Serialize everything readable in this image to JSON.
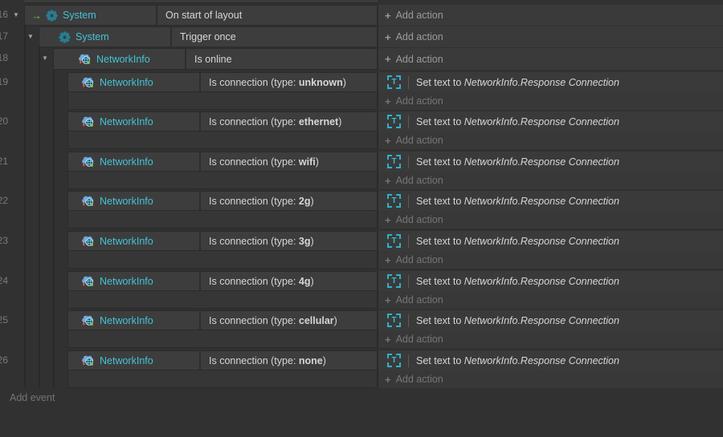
{
  "icons": {
    "plus": "+",
    "collapse": "▼",
    "trigger_arrow": "→",
    "text_object": "T"
  },
  "colors": {
    "object_name": "#44c3d8",
    "trigger_arrow_green": "#74c044",
    "gear_teal": "#267f95",
    "text_icon_cyan": "#35bdd6",
    "background": "#313131",
    "block": "#3d3d3d"
  },
  "sheet": {
    "add_event_label": "Add event",
    "add_action_label": "Add action",
    "events": [
      {
        "number": "16",
        "object": "System",
        "icon": "gear",
        "trigger_arrow": true,
        "collapsible": true,
        "condition": {
          "pre": "On start of layout",
          "bold": "",
          "post": ""
        },
        "actions": []
      },
      {
        "number": "17",
        "object": "System",
        "icon": "gear",
        "trigger_arrow": false,
        "collapsible": true,
        "condition": {
          "pre": "Trigger once",
          "bold": "",
          "post": ""
        },
        "actions": []
      },
      {
        "number": "18",
        "object": "NetworkInfo",
        "icon": "network",
        "trigger_arrow": false,
        "collapsible": true,
        "condition": {
          "pre": "Is online",
          "bold": "",
          "post": ""
        },
        "actions": []
      },
      {
        "number": "19",
        "object": "NetworkInfo",
        "icon": "network",
        "trigger_arrow": false,
        "collapsible": false,
        "condition": {
          "pre": "Is connection (type: ",
          "bold": "unknown",
          "post": ")"
        },
        "actions": [
          {
            "icon": "text",
            "text": "Set text to ",
            "expression": "NetworkInfo.Response Connection"
          }
        ]
      },
      {
        "number": "20",
        "object": "NetworkInfo",
        "icon": "network",
        "trigger_arrow": false,
        "collapsible": false,
        "condition": {
          "pre": "Is connection (type: ",
          "bold": "ethernet",
          "post": ")"
        },
        "actions": [
          {
            "icon": "text",
            "text": "Set text to ",
            "expression": "NetworkInfo.Response Connection"
          }
        ]
      },
      {
        "number": "21",
        "object": "NetworkInfo",
        "icon": "network",
        "trigger_arrow": false,
        "collapsible": false,
        "condition": {
          "pre": "Is connection (type: ",
          "bold": "wifi",
          "post": ")"
        },
        "actions": [
          {
            "icon": "text",
            "text": "Set text to ",
            "expression": "NetworkInfo.Response Connection"
          }
        ]
      },
      {
        "number": "22",
        "object": "NetworkInfo",
        "icon": "network",
        "trigger_arrow": false,
        "collapsible": false,
        "condition": {
          "pre": "Is connection (type: ",
          "bold": "2g",
          "post": ")"
        },
        "actions": [
          {
            "icon": "text",
            "text": "Set text to ",
            "expression": "NetworkInfo.Response Connection"
          }
        ]
      },
      {
        "number": "23",
        "object": "NetworkInfo",
        "icon": "network",
        "trigger_arrow": false,
        "collapsible": false,
        "condition": {
          "pre": "Is connection (type: ",
          "bold": "3g",
          "post": ")"
        },
        "actions": [
          {
            "icon": "text",
            "text": "Set text to ",
            "expression": "NetworkInfo.Response Connection"
          }
        ]
      },
      {
        "number": "24",
        "object": "NetworkInfo",
        "icon": "network",
        "trigger_arrow": false,
        "collapsible": false,
        "condition": {
          "pre": "Is connection (type: ",
          "bold": "4g",
          "post": ")"
        },
        "actions": [
          {
            "icon": "text",
            "text": "Set text to ",
            "expression": "NetworkInfo.Response Connection"
          }
        ]
      },
      {
        "number": "25",
        "object": "NetworkInfo",
        "icon": "network",
        "trigger_arrow": false,
        "collapsible": false,
        "condition": {
          "pre": "Is connection (type: ",
          "bold": "cellular",
          "post": ")"
        },
        "actions": [
          {
            "icon": "text",
            "text": "Set text to ",
            "expression": "NetworkInfo.Response Connection"
          }
        ]
      },
      {
        "number": "26",
        "object": "NetworkInfo",
        "icon": "network",
        "trigger_arrow": false,
        "collapsible": false,
        "condition": {
          "pre": "Is connection (type: ",
          "bold": "none",
          "post": ")"
        },
        "actions": [
          {
            "icon": "text",
            "text": "Set text to ",
            "expression": "NetworkInfo.Response Connection"
          }
        ]
      }
    ]
  }
}
